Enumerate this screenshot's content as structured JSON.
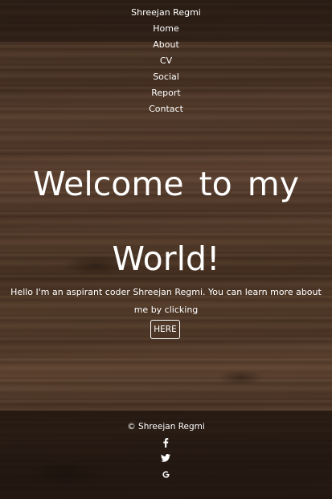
{
  "header": {
    "brand": "Shreejan Regmi",
    "nav": [
      {
        "label": "Home"
      },
      {
        "label": "About"
      },
      {
        "label": "CV"
      },
      {
        "label": "Social"
      },
      {
        "label": "Report"
      },
      {
        "label": "Contact"
      }
    ]
  },
  "hero": {
    "title": "Welcome  to  my World!",
    "text": "Hello I'm an aspirant coder Shreejan Regmi. You can learn more about me by clicking",
    "button_label": "HERE"
  },
  "footer": {
    "copyright": "© Shreejan Regmi",
    "social": [
      {
        "icon": "facebook-icon"
      },
      {
        "icon": "twitter-icon"
      },
      {
        "icon": "google-icon"
      }
    ]
  },
  "colors": {
    "text": "#ffffff",
    "background_wood": "#4e3726",
    "footer_overlay": "#19110c"
  }
}
